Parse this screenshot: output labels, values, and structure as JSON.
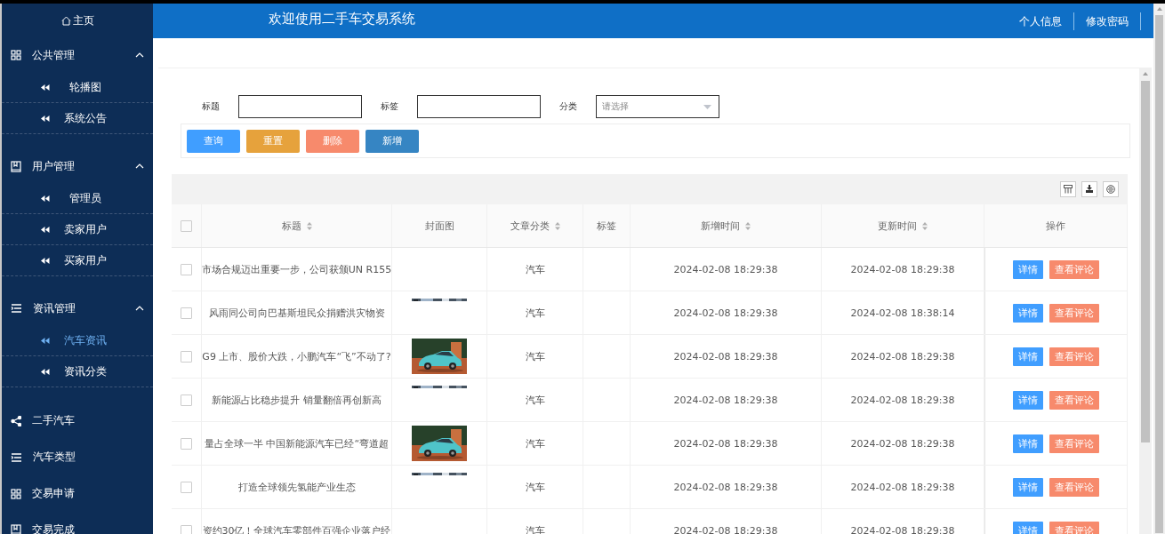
{
  "sidebar": {
    "home": "主页",
    "groups": [
      {
        "label": "公共管理",
        "expanded": true,
        "children": [
          {
            "label": "轮播图",
            "selected": false
          },
          {
            "label": "系统公告",
            "selected": false
          }
        ]
      },
      {
        "label": "用户管理",
        "expanded": true,
        "children": [
          {
            "label": "管理员",
            "selected": false
          },
          {
            "label": "卖家用户",
            "selected": false
          },
          {
            "label": "买家用户",
            "selected": false
          }
        ]
      },
      {
        "label": "资讯管理",
        "expanded": true,
        "children": [
          {
            "label": "汽车资讯",
            "selected": true
          },
          {
            "label": "资讯分类",
            "selected": false
          }
        ]
      }
    ],
    "items": [
      {
        "label": "二手汽车",
        "selected": false
      },
      {
        "label": "汽车类型",
        "selected": false
      },
      {
        "label": "交易申请",
        "selected": false
      },
      {
        "label": "交易完成",
        "selected": false
      }
    ]
  },
  "header": {
    "title": "欢迎使用二手车交易系统",
    "links": [
      "个人信息",
      "修改密码"
    ]
  },
  "search": {
    "fields": [
      {
        "label": "标题",
        "kind": "input"
      },
      {
        "label": "标签",
        "kind": "input"
      },
      {
        "label": "分类",
        "kind": "select",
        "placeholder": "请选择"
      }
    ],
    "buttons": [
      {
        "label": "查询",
        "color": "#409eff"
      },
      {
        "label": "重置",
        "color": "#e6a23c"
      },
      {
        "label": "删除",
        "color": "#f78a6c"
      },
      {
        "label": "新增",
        "color": "#3685c3"
      }
    ]
  },
  "table": {
    "all_checked": false,
    "columns": [
      {
        "label": "标题",
        "sortable": true
      },
      {
        "label": "封面图",
        "sortable": false
      },
      {
        "label": "文章分类",
        "sortable": true
      },
      {
        "label": "标签",
        "sortable": false
      },
      {
        "label": "新增时间",
        "sortable": true
      },
      {
        "label": "更新时间",
        "sortable": true
      },
      {
        "label": "操作",
        "sortable": false
      }
    ],
    "rows": [
      {
        "checked": false,
        "title": "市场合规迈出重要一步，公司获颁UN R155",
        "category": "汽车",
        "created": "2024-02-08 18:29:38",
        "updated": "2024-02-08 18:29:38",
        "actions": [
          "详情",
          "查看评论"
        ]
      },
      {
        "checked": false,
        "title": "风雨同公司向巴基斯坦民众捐赠洪灾物资",
        "cover": {
          "kind": "strip"
        },
        "category": "汽车",
        "created": "2024-02-08 18:29:38",
        "updated": "2024-02-08 18:38:14",
        "actions": [
          "详情",
          "查看评论"
        ]
      },
      {
        "checked": false,
        "title": "G9 上市、股价大跌，小鹏汽车“飞”不动了?",
        "cover": {
          "kind": "picture"
        },
        "category": "汽车",
        "created": "2024-02-08 18:29:38",
        "updated": "2024-02-08 18:29:38",
        "actions": [
          "详情",
          "查看评论"
        ]
      },
      {
        "checked": false,
        "title": "新能源占比稳步提升 销量翻倍再创新高",
        "cover": {
          "kind": "strip"
        },
        "category": "汽车",
        "created": "2024-02-08 18:29:38",
        "updated": "2024-02-08 18:29:38",
        "actions": [
          "详情",
          "查看评论"
        ]
      },
      {
        "checked": false,
        "title": "量占全球一半 中国新能源汽车已经“弯道超",
        "cover": {
          "kind": "picture"
        },
        "category": "汽车",
        "created": "2024-02-08 18:29:38",
        "updated": "2024-02-08 18:29:38",
        "actions": [
          "详情",
          "查看评论"
        ]
      },
      {
        "checked": false,
        "title": "打造全球领先氢能产业生态",
        "cover": {
          "kind": "strip"
        },
        "category": "汽车",
        "created": "2024-02-08 18:29:38",
        "updated": "2024-02-08 18:29:38",
        "actions": [
          "详情",
          "查看评论"
        ]
      },
      {
        "checked": false,
        "title": "资约30亿！全球汽车零部件百强企业落户经",
        "category": "汽车",
        "created": "2024-02-08 18:29:38",
        "updated": "2024-02-08 18:29:38",
        "actions": [
          "详情",
          "查看评论"
        ]
      }
    ]
  }
}
